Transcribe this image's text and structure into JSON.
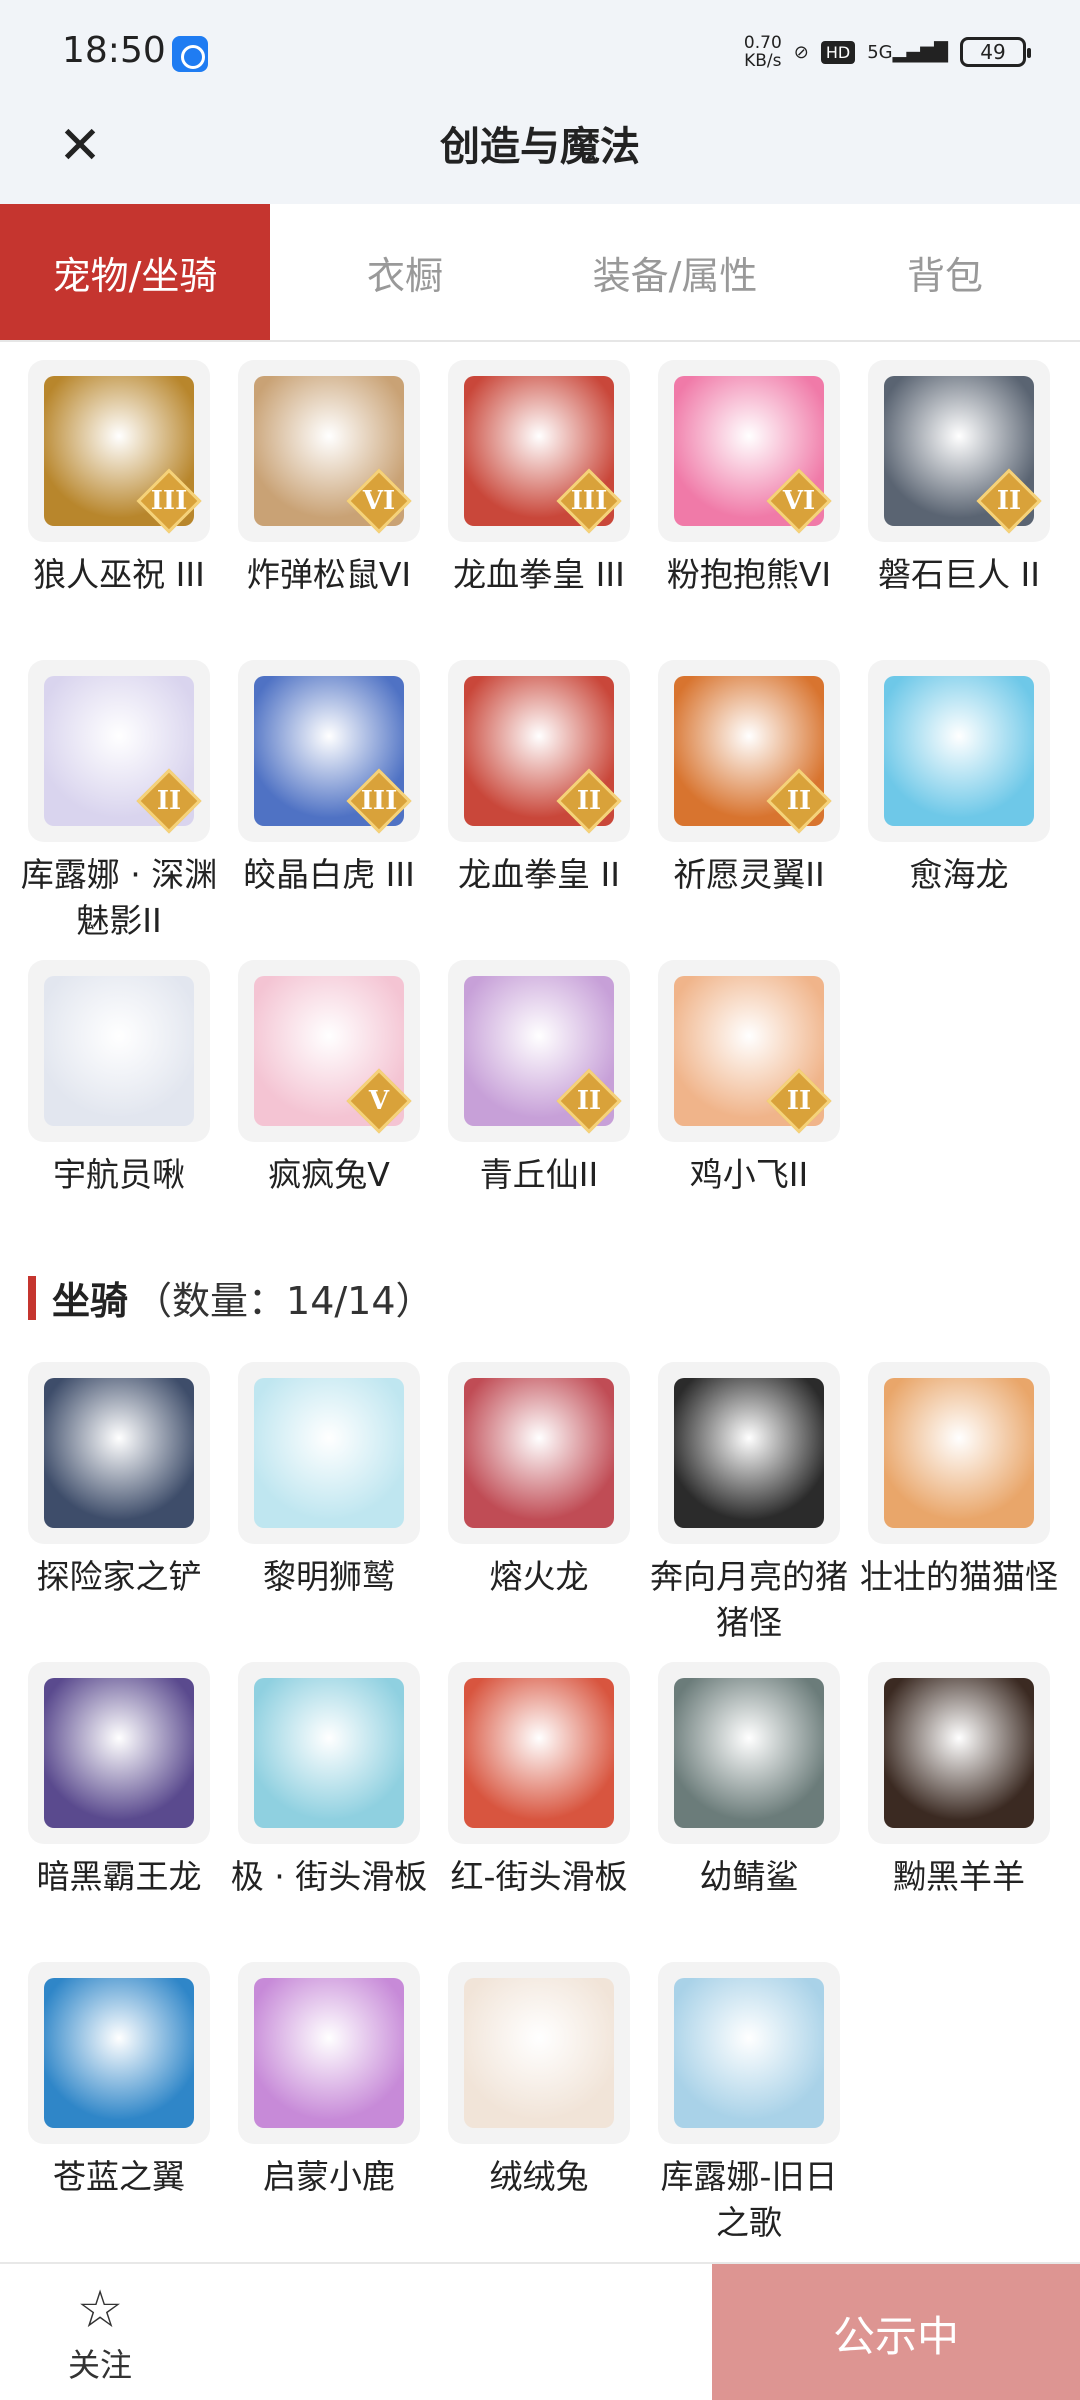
{
  "status_bar": {
    "time": "18:50",
    "net_speed_value": "0.70",
    "net_speed_unit": "KB/s",
    "hd": "HD",
    "signal": "5G",
    "battery": "49"
  },
  "header": {
    "close_icon": "close-icon",
    "title": "创造与魔法"
  },
  "tabs": [
    {
      "label": "宠物/坐骑",
      "active": true
    },
    {
      "label": "衣橱",
      "active": false
    },
    {
      "label": "装备/属性",
      "active": false
    },
    {
      "label": "背包",
      "active": false
    }
  ],
  "pets": [
    {
      "name": "狼人巫祝 III",
      "tier": "III",
      "color": "#b8862c"
    },
    {
      "name": "炸弹松鼠VI",
      "tier": "VI",
      "color": "#c9a275"
    },
    {
      "name": "龙血拳皇 III",
      "tier": "III",
      "color": "#c9473a"
    },
    {
      "name": "粉抱抱熊VI",
      "tier": "VI",
      "color": "#f07aa8"
    },
    {
      "name": "磐石巨人 II",
      "tier": "II",
      "color": "#5a6472"
    },
    {
      "name": "库露娜 · 深渊魅影II",
      "tier": "II",
      "color": "#d9d4ee"
    },
    {
      "name": "皎晶白虎 III",
      "tier": "III",
      "color": "#4f72c4"
    },
    {
      "name": "龙血拳皇 II",
      "tier": "II",
      "color": "#c9473a"
    },
    {
      "name": "祈愿灵翼II",
      "tier": "II",
      "color": "#d8742f"
    },
    {
      "name": "愈海龙",
      "tier": "",
      "color": "#6ec8e8"
    },
    {
      "name": "宇航员啾",
      "tier": "",
      "color": "#e2e6ef"
    },
    {
      "name": "疯疯兔V",
      "tier": "V",
      "color": "#f4c4d3"
    },
    {
      "name": "青丘仙II",
      "tier": "II",
      "color": "#c7a0d8"
    },
    {
      "name": "鸡小飞II",
      "tier": "II",
      "color": "#f0b48a"
    }
  ],
  "mounts_section": {
    "title": "坐骑",
    "count": "（数量：14/14）"
  },
  "mounts": [
    {
      "name": "探险家之铲",
      "color": "#3e4d6a"
    },
    {
      "name": "黎明狮鹫",
      "color": "#bfe6f0"
    },
    {
      "name": "熔火龙",
      "color": "#c04c55"
    },
    {
      "name": "奔向月亮的猪猪怪",
      "color": "#2b2b2b"
    },
    {
      "name": "壮壮的猫猫怪",
      "color": "#e9a66a"
    },
    {
      "name": "暗黑霸王龙",
      "color": "#5a4a8e"
    },
    {
      "name": "极 · 街头滑板",
      "color": "#8fd0e0"
    },
    {
      "name": "红-街头滑板",
      "color": "#d8553f"
    },
    {
      "name": "幼鲭鲨",
      "color": "#6b7c7a"
    },
    {
      "name": "黝黑羊羊",
      "color": "#3b2a22"
    },
    {
      "name": "苍蓝之翼",
      "color": "#2f86c8"
    },
    {
      "name": "启蒙小鹿",
      "color": "#c78ad8"
    },
    {
      "name": "绒绒兔",
      "color": "#f1e4d8"
    },
    {
      "name": "库露娜-旧日之歌",
      "color": "#a9d2e8"
    }
  ],
  "bottom_bar": {
    "follow_icon": "star-icon",
    "follow_label": "关注",
    "status_label": "公示中"
  }
}
